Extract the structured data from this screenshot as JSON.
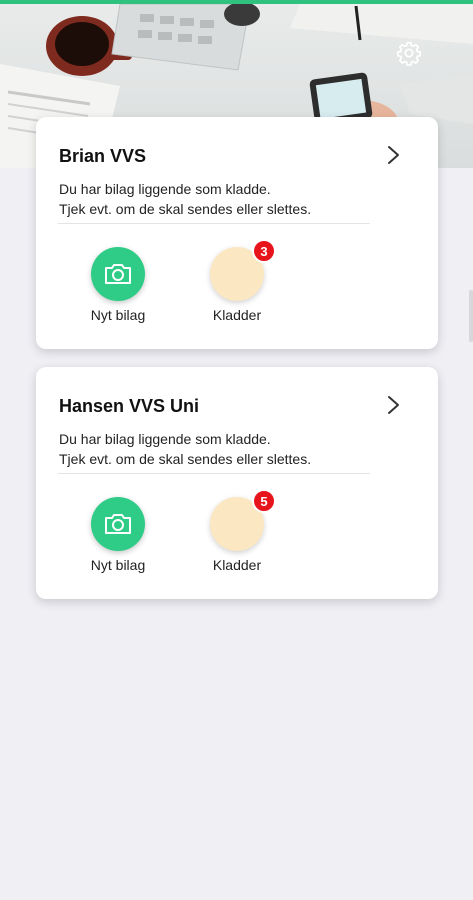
{
  "colors": {
    "accent": "#2ecc86",
    "drafts": "#fbe8c3",
    "badge": "#e8141c",
    "background": "#efeff4"
  },
  "header": {
    "settings_icon": "gear-icon"
  },
  "companies": [
    {
      "name": "Brian VVS",
      "message_line1": "Du har bilag liggende som kladde.",
      "message_line2": "Tjek evt. om de skal sendes eller slettes.",
      "new_label": "Nyt bilag",
      "drafts_label": "Kladder",
      "drafts_count": "3"
    },
    {
      "name": "Hansen VVS Uni",
      "message_line1": "Du har bilag liggende som kladde.",
      "message_line2": "Tjek evt. om de skal sendes eller slettes.",
      "new_label": "Nyt bilag",
      "drafts_label": "Kladder",
      "drafts_count": "5"
    }
  ]
}
